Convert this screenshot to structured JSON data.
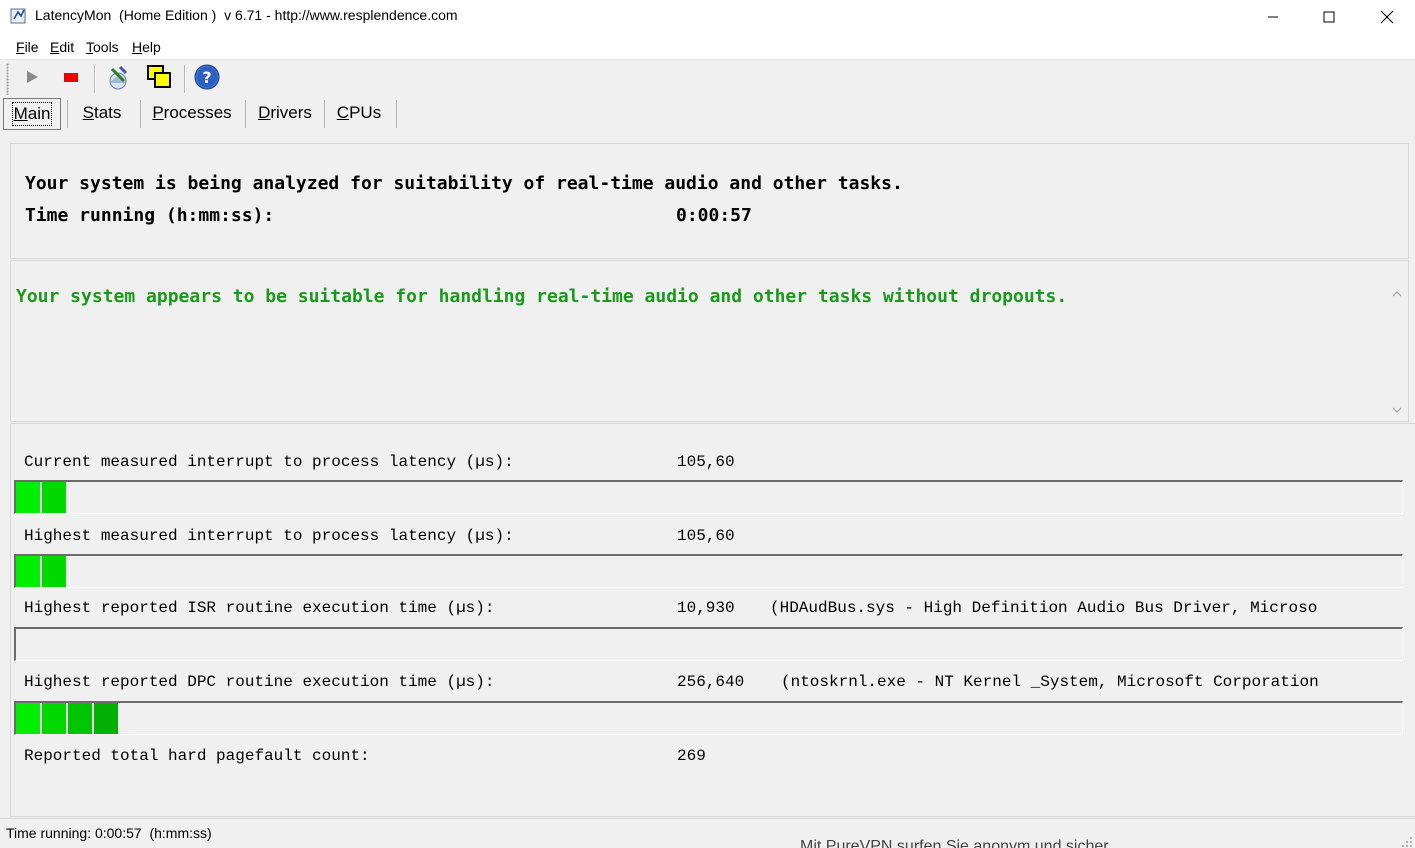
{
  "window": {
    "title": "LatencyMon  (Home Edition )  v 6.71 - http://www.resplendence.com",
    "minimize_icon": "minimize-icon",
    "maximize_icon": "maximize-icon",
    "close_icon": "close-icon"
  },
  "menu": {
    "items": [
      {
        "mnemonic": "F",
        "rest": "ile"
      },
      {
        "mnemonic": "E",
        "rest": "dit"
      },
      {
        "mnemonic": "T",
        "rest": "ools"
      },
      {
        "mnemonic": "H",
        "rest": "elp"
      }
    ]
  },
  "toolbar": {
    "buttons": [
      "play-icon",
      "stop-icon",
      "analyze-icon",
      "windows-icon",
      "help-icon"
    ]
  },
  "tabs": [
    {
      "mnemonic": "M",
      "rest": "ain",
      "active": true
    },
    {
      "mnemonic": "S",
      "rest": "tats",
      "active": false
    },
    {
      "mnemonic": "P",
      "rest": "rocesses",
      "active": false
    },
    {
      "mnemonic": "D",
      "rest": "rivers",
      "active": false
    },
    {
      "mnemonic": "C",
      "rest": "PUs",
      "active": false
    }
  ],
  "status_panel": {
    "line1": "Your system is being analyzed for suitability of real-time audio and other tasks.",
    "time_label": "Time running (h:mm:ss):",
    "time_value": "0:00:57"
  },
  "verdict": {
    "text": "Your system appears to be suitable for handling real-time audio and other tasks without dropouts.",
    "color": "#1a9a1a"
  },
  "metrics": [
    {
      "label": "Current measured interrupt to process latency (µs):",
      "value": "105,60",
      "detail": "",
      "bar_segments": 2
    },
    {
      "label": "Highest measured interrupt to process latency (µs):",
      "value": "105,60",
      "detail": "",
      "bar_segments": 2
    },
    {
      "label": "Highest reported ISR routine execution time (µs):",
      "value": "10,930",
      "detail": "(HDAudBus.sys - High Definition Audio Bus Driver, Microso",
      "bar_segments": 0
    },
    {
      "label": "Highest reported DPC routine execution time (µs):",
      "value": "256,640",
      "detail": "(ntoskrnl.exe - NT Kernel _System, Microsoft Corporation",
      "bar_segments": 4
    },
    {
      "label": "Reported total hard pagefault count:",
      "value": "269",
      "detail": ""
    }
  ],
  "bar_colors": [
    "#00ee00",
    "#00d800",
    "#00c400",
    "#00b000"
  ],
  "statusbar": {
    "text": "Time running: 0:00:57  (h:mm:ss)"
  },
  "background_peek": {
    "text": "Mit PureVPN surfen Sie anonym und sicher"
  }
}
